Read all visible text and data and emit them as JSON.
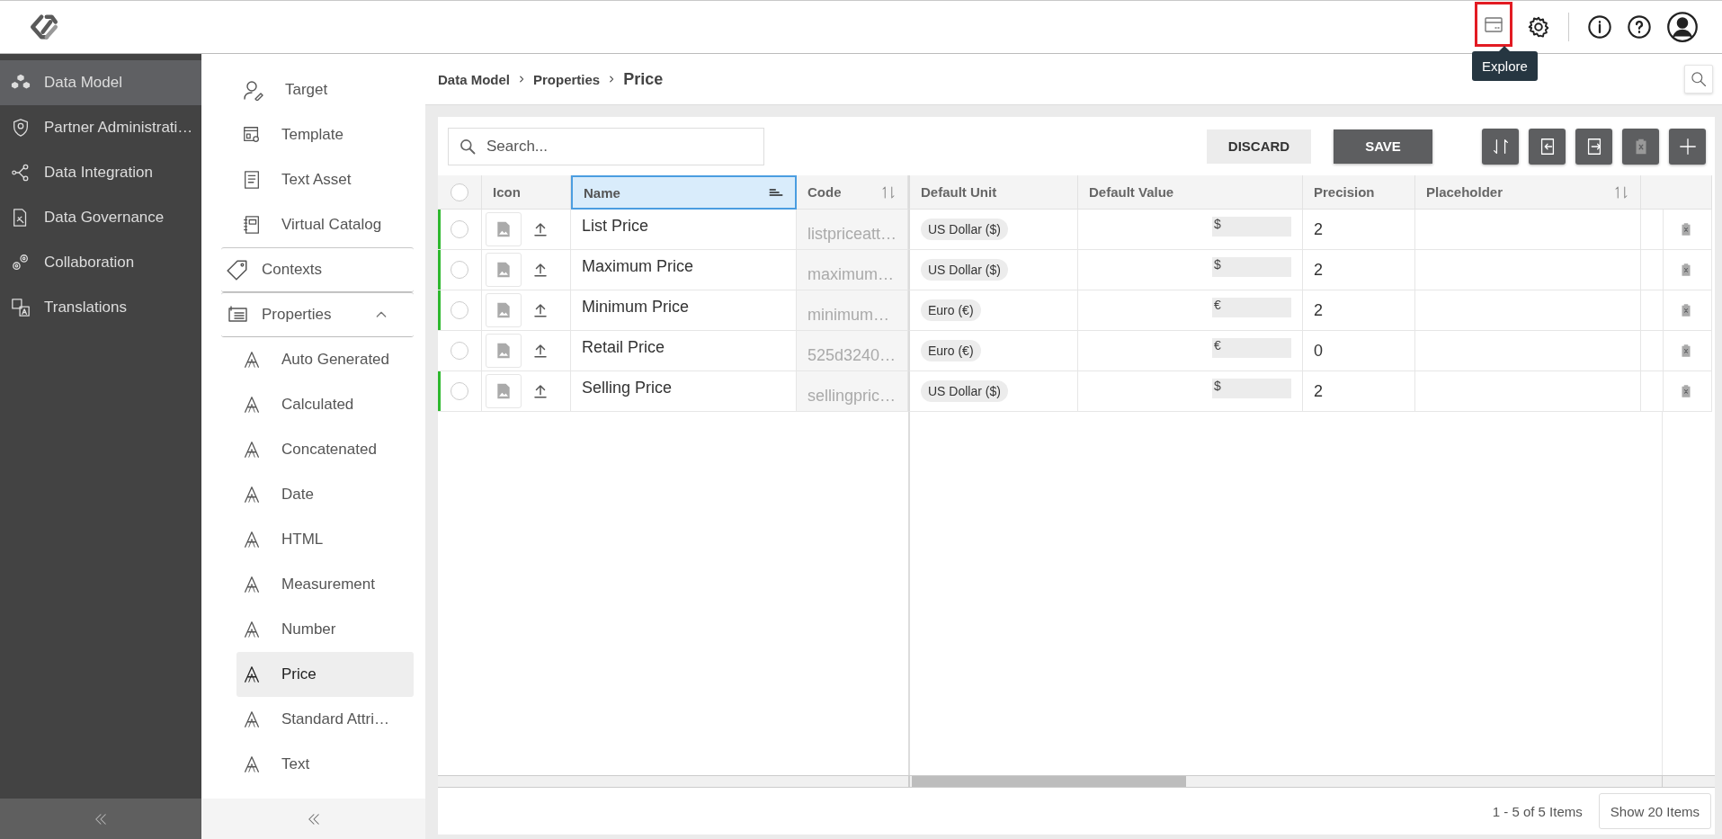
{
  "header": {
    "tooltip": "Explore"
  },
  "sidebar": {
    "items": [
      {
        "label": "Data Model",
        "kind": "model",
        "selected": true
      },
      {
        "label": "Partner Administrati…",
        "kind": "partner",
        "selected": false
      },
      {
        "label": "Data Integration",
        "kind": "integration",
        "selected": false
      },
      {
        "label": "Data Governance",
        "kind": "governance",
        "selected": false
      },
      {
        "label": "Collaboration",
        "kind": "collaboration",
        "selected": false
      },
      {
        "label": "Translations",
        "kind": "translations",
        "selected": false
      }
    ]
  },
  "subnav": {
    "continued_children": [
      {
        "label": "Target",
        "kind": "target",
        "selected": false
      },
      {
        "label": "Template",
        "kind": "template",
        "selected": false
      },
      {
        "label": "Text Asset",
        "kind": "textasset",
        "selected": false
      },
      {
        "label": "Virtual Catalog",
        "kind": "catalog",
        "selected": false
      }
    ],
    "items": [
      {
        "label": "Contexts",
        "kind": "tag",
        "selected": false
      },
      {
        "label": "Properties",
        "kind": "properties",
        "selected": false,
        "expanded": true,
        "children": [
          {
            "label": "Auto Generated",
            "kind": "attribute",
            "selected": false
          },
          {
            "label": "Calculated",
            "kind": "attribute",
            "selected": false
          },
          {
            "label": "Concatenated",
            "kind": "attribute",
            "selected": false
          },
          {
            "label": "Date",
            "kind": "attribute",
            "selected": false
          },
          {
            "label": "HTML",
            "kind": "attribute",
            "selected": false
          },
          {
            "label": "Measurement",
            "kind": "attribute",
            "selected": false
          },
          {
            "label": "Number",
            "kind": "attribute",
            "selected": false
          },
          {
            "label": "Price",
            "kind": "attribute",
            "selected": true
          },
          {
            "label": "Standard Attri…",
            "kind": "attribute",
            "selected": false
          },
          {
            "label": "Text",
            "kind": "attribute",
            "selected": false
          }
        ]
      }
    ]
  },
  "breadcrumb": [
    "Data Model",
    "Properties",
    "Price"
  ],
  "toolbar": {
    "search": {
      "placeholder": "Search..."
    },
    "buttons": [
      {
        "label": "DISCARD",
        "kind": "secondary"
      },
      {
        "label": "SAVE",
        "kind": "primary"
      }
    ],
    "icon_buttons": [
      {
        "kind": "refresh",
        "disabled": false
      },
      {
        "kind": "import",
        "disabled": false
      },
      {
        "kind": "export",
        "disabled": false
      },
      {
        "kind": "delete",
        "disabled": true
      },
      {
        "kind": "add",
        "disabled": false
      }
    ]
  },
  "table": {
    "all_selected": false,
    "columns": [
      {
        "label": "Icon",
        "selected": false,
        "sorted": false,
        "sortable": false
      },
      {
        "label": "Name",
        "selected": true,
        "sorted": true,
        "sortable": false
      },
      {
        "label": "Code",
        "selected": false,
        "sorted": false,
        "sortable": true
      },
      {
        "label": "Default Unit",
        "selected": false,
        "sorted": false,
        "sortable": false
      },
      {
        "label": "Default Value",
        "selected": false,
        "sorted": false,
        "sortable": false
      },
      {
        "label": "Precision",
        "selected": false,
        "sorted": false,
        "sortable": false
      },
      {
        "label": "Placeholder",
        "selected": false,
        "sorted": false,
        "sortable": true
      }
    ],
    "rows": [
      {
        "name": "List Price",
        "code": "listpriceatt…",
        "unit": "US Dollar ($)",
        "value": "$",
        "precision": "2",
        "modified": true,
        "selected": false
      },
      {
        "name": "Maximum Price",
        "code": "maximum…",
        "unit": "US Dollar ($)",
        "value": "$",
        "precision": "2",
        "modified": true,
        "selected": false
      },
      {
        "name": "Minimum Price",
        "code": "minimum…",
        "unit": "Euro (€)",
        "value": "€",
        "precision": "2",
        "modified": true,
        "selected": false
      },
      {
        "name": "Retail Price",
        "code": "525d3240…",
        "unit": "Euro (€)",
        "value": "€",
        "precision": "0",
        "modified": false,
        "selected": false
      },
      {
        "name": "Selling Price",
        "code": "sellingpric…",
        "unit": "US Dollar ($)",
        "value": "$",
        "precision": "2",
        "modified": true,
        "selected": false
      }
    ]
  },
  "footer": {
    "summary": "1 - 5 of 5 Items",
    "page_size": "Show 20 Items"
  }
}
